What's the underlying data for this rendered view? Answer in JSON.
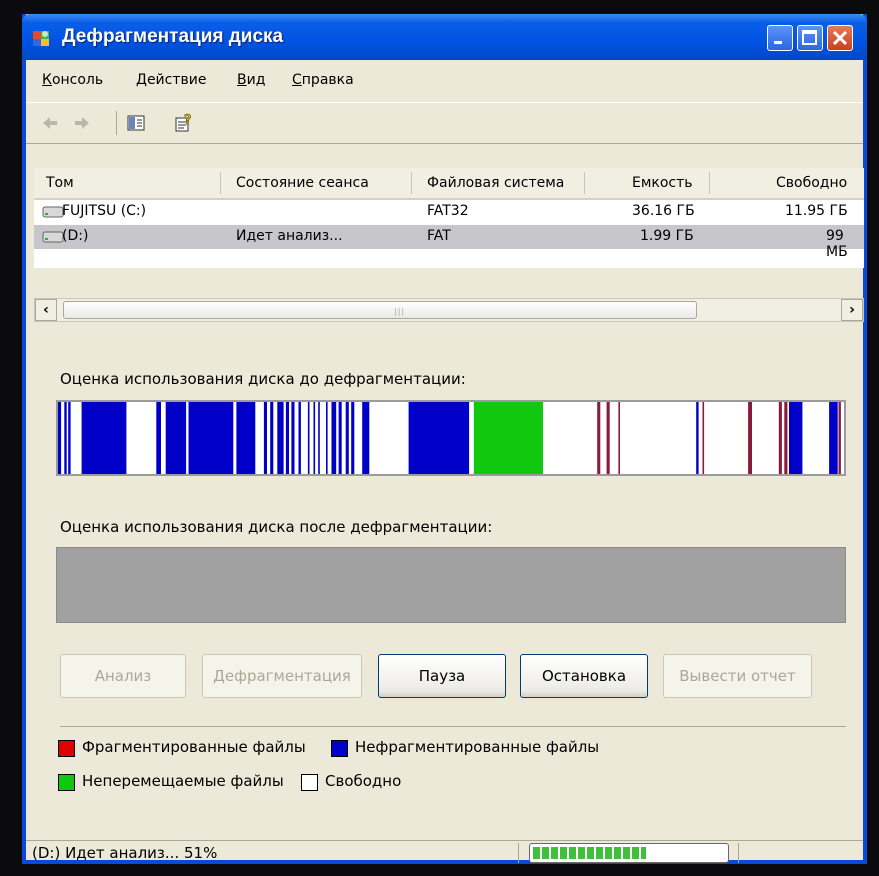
{
  "window": {
    "title": "Дефрагментация диска"
  },
  "menu": {
    "items": [
      "Консоль",
      "Действие",
      "Вид",
      "Справка"
    ]
  },
  "toolbar": {
    "icons": [
      "back-arrow-icon",
      "forward-arrow-icon",
      "show-hide-tree-icon",
      "help-icon"
    ]
  },
  "columns": [
    "Том",
    "Состояние сеанса",
    "Файловая система",
    "Емкость",
    "Свободно"
  ],
  "volumes": [
    {
      "name": "FUJITSU (C:)",
      "status": "",
      "fs": "FAT32",
      "capacity": "36.16 ГБ",
      "free": "11.95 ГБ"
    },
    {
      "name": "(D:)",
      "status": "Идет анализ...",
      "fs": "FAT",
      "capacity": "1.99 ГБ",
      "free": "99 МБ"
    }
  ],
  "labels": {
    "before": "Оценка использования диска до дефрагментации:",
    "after": "Оценка использования диска после дефрагментации:"
  },
  "buttons": {
    "analyze": "Анализ",
    "defrag": "Дефрагментация",
    "pause": "Пауза",
    "stop": "Остановка",
    "report": "Вывести отчет"
  },
  "legend": {
    "fragmented": "Фрагментированные файлы",
    "contiguous": "Нефрагментированные файлы",
    "unmovable": "Неперемещаемые файлы",
    "free": "Свободно"
  },
  "colors": {
    "fragmented": "#E00000",
    "contiguous": "#0000C8",
    "unmovable": "#10C810",
    "free": "#FFFFFF",
    "fragmented_bar": "#8B1A3A"
  },
  "status": {
    "text": "(D:) Идет анализ... 51%",
    "progress": 0.51
  },
  "disk_map_before": [
    {
      "start": 0.0,
      "end": 0.004,
      "type": "contiguous"
    },
    {
      "start": 0.008,
      "end": 0.011,
      "type": "contiguous"
    },
    {
      "start": 0.013,
      "end": 0.016,
      "type": "contiguous"
    },
    {
      "start": 0.03,
      "end": 0.087,
      "type": "contiguous"
    },
    {
      "start": 0.125,
      "end": 0.131,
      "type": "contiguous"
    },
    {
      "start": 0.137,
      "end": 0.163,
      "type": "contiguous"
    },
    {
      "start": 0.166,
      "end": 0.223,
      "type": "contiguous"
    },
    {
      "start": 0.227,
      "end": 0.251,
      "type": "contiguous"
    },
    {
      "start": 0.262,
      "end": 0.266,
      "type": "contiguous"
    },
    {
      "start": 0.27,
      "end": 0.274,
      "type": "contiguous"
    },
    {
      "start": 0.279,
      "end": 0.287,
      "type": "contiguous"
    },
    {
      "start": 0.29,
      "end": 0.294,
      "type": "contiguous"
    },
    {
      "start": 0.297,
      "end": 0.301,
      "type": "contiguous"
    },
    {
      "start": 0.306,
      "end": 0.309,
      "type": "contiguous"
    },
    {
      "start": 0.318,
      "end": 0.32,
      "type": "contiguous"
    },
    {
      "start": 0.325,
      "end": 0.327,
      "type": "contiguous"
    },
    {
      "start": 0.331,
      "end": 0.333,
      "type": "contiguous"
    },
    {
      "start": 0.341,
      "end": 0.343,
      "type": "contiguous"
    },
    {
      "start": 0.348,
      "end": 0.354,
      "type": "contiguous"
    },
    {
      "start": 0.357,
      "end": 0.361,
      "type": "contiguous"
    },
    {
      "start": 0.366,
      "end": 0.37,
      "type": "contiguous"
    },
    {
      "start": 0.373,
      "end": 0.377,
      "type": "contiguous"
    },
    {
      "start": 0.387,
      "end": 0.396,
      "type": "contiguous"
    },
    {
      "start": 0.446,
      "end": 0.523,
      "type": "contiguous"
    },
    {
      "start": 0.529,
      "end": 0.617,
      "type": "unmovable"
    },
    {
      "start": 0.686,
      "end": 0.69,
      "type": "fragmented_bar"
    },
    {
      "start": 0.698,
      "end": 0.702,
      "type": "fragmented_bar"
    },
    {
      "start": 0.713,
      "end": 0.715,
      "type": "fragmented_bar"
    },
    {
      "start": 0.812,
      "end": 0.815,
      "type": "contiguous"
    },
    {
      "start": 0.82,
      "end": 0.822,
      "type": "fragmented_bar"
    },
    {
      "start": 0.878,
      "end": 0.883,
      "type": "fragmented_bar"
    },
    {
      "start": 0.917,
      "end": 0.921,
      "type": "fragmented_bar"
    },
    {
      "start": 0.924,
      "end": 0.928,
      "type": "fragmented_bar"
    },
    {
      "start": 0.93,
      "end": 0.947,
      "type": "contiguous"
    },
    {
      "start": 0.981,
      "end": 0.992,
      "type": "contiguous"
    },
    {
      "start": 0.993,
      "end": 0.996,
      "type": "fragmented_bar"
    }
  ]
}
